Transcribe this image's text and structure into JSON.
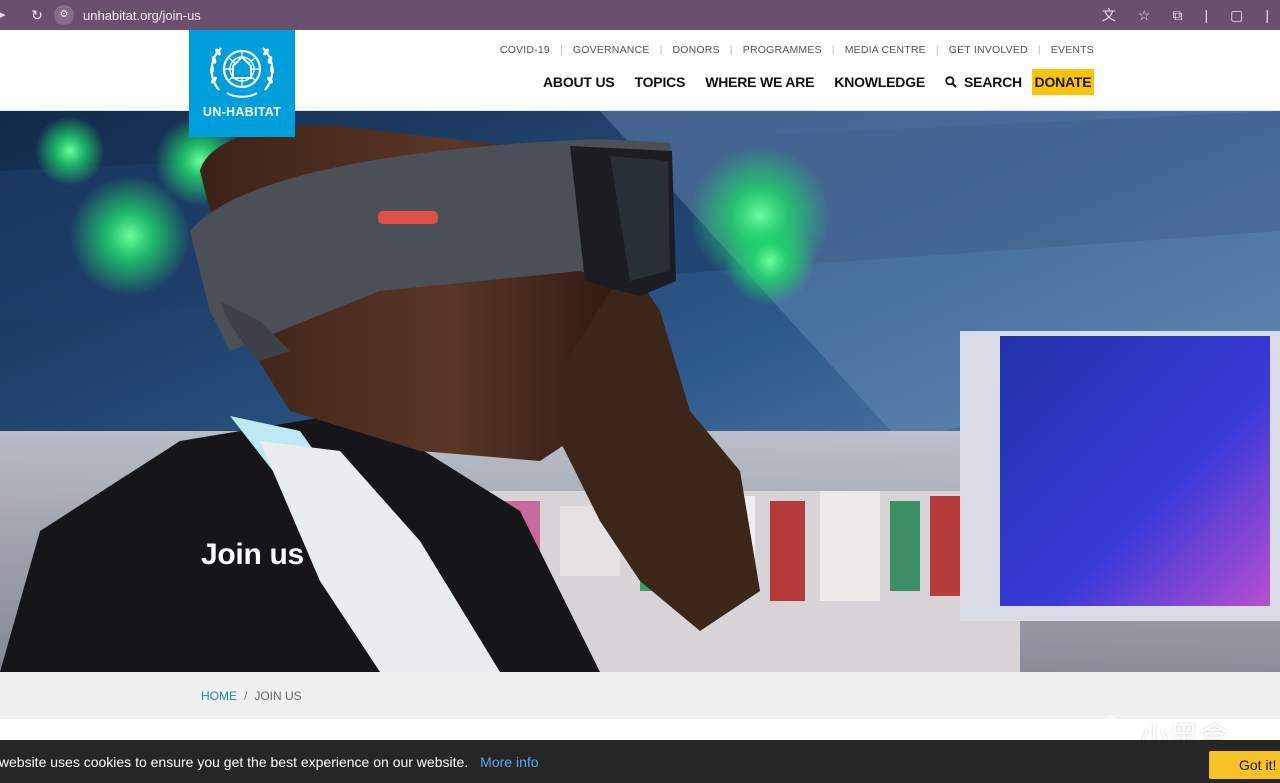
{
  "browser": {
    "url": "unhabitat.org/join-us",
    "icons": [
      "translate-icon",
      "bookmark-star-icon",
      "extensions-icon",
      "reader-mode-icon"
    ]
  },
  "logo": {
    "text": "UN-HABITAT"
  },
  "top_links": [
    "COVID-19",
    "GOVERNANCE",
    "DONORS",
    "PROGRAMMES",
    "MEDIA CENTRE",
    "GET INVOLVED",
    "EVENTS"
  ],
  "main_nav": {
    "items": [
      "ABOUT US",
      "TOPICS",
      "WHERE WE ARE",
      "KNOWLEDGE"
    ],
    "search_label": "SEARCH",
    "donate_label": "DONATE"
  },
  "hero": {
    "title": "Join us"
  },
  "breadcrumb": {
    "home": "HOME",
    "separator": "/",
    "current": "JOIN US"
  },
  "cookie": {
    "text": "s website uses cookies to ensure you get the best experience on our website.",
    "more_info": "More info",
    "accept": "Got it!"
  },
  "watermark": {
    "text": "小黑盒"
  },
  "colors": {
    "browser_bar": "#6b4f6e",
    "logo_blue": "#009edb",
    "donate_yellow": "#fcc30b",
    "link_blue": "#1a86c6",
    "cookie_bg": "#262626",
    "cookie_button": "#f6c226"
  }
}
